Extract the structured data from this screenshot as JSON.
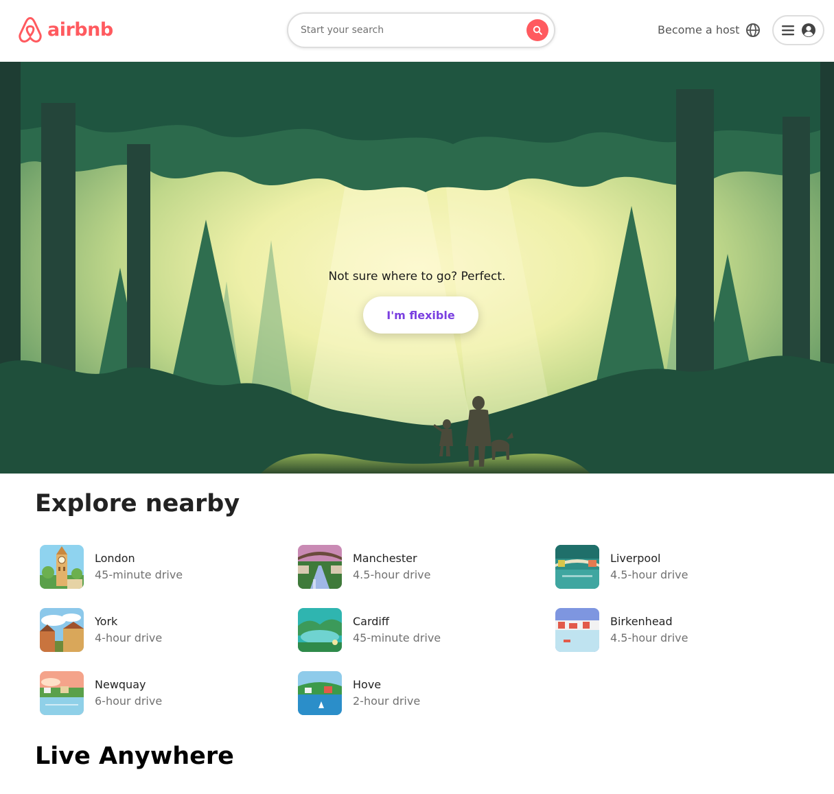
{
  "header": {
    "brand": "airbnb",
    "search_placeholder": "Start your search",
    "host_label": "Become a host"
  },
  "hero": {
    "tagline": "Not sure where to go? Perfect.",
    "button_label": "I'm flexible"
  },
  "explore": {
    "title": "Explore nearby",
    "places": [
      {
        "name": "London",
        "distance": "45-minute drive"
      },
      {
        "name": "Manchester",
        "distance": "4.5-hour drive"
      },
      {
        "name": "Liverpool",
        "distance": "4.5-hour drive"
      },
      {
        "name": "York",
        "distance": "4-hour drive"
      },
      {
        "name": "Cardiff",
        "distance": "45-minute drive"
      },
      {
        "name": "Birkenhead",
        "distance": "4.5-hour drive"
      },
      {
        "name": "Newquay",
        "distance": "6-hour drive"
      },
      {
        "name": "Hove",
        "distance": "2-hour drive"
      }
    ]
  },
  "live": {
    "title": "Live Anywhere"
  },
  "colors": {
    "brand": "#ff5a5f",
    "accent_button_text": "#7a3fe0",
    "muted_text": "#717171"
  },
  "icons": {
    "logo": "airbnb-logo-icon",
    "search": "search-icon",
    "globe": "globe-icon",
    "menu": "hamburger-icon",
    "user": "user-avatar-icon"
  }
}
